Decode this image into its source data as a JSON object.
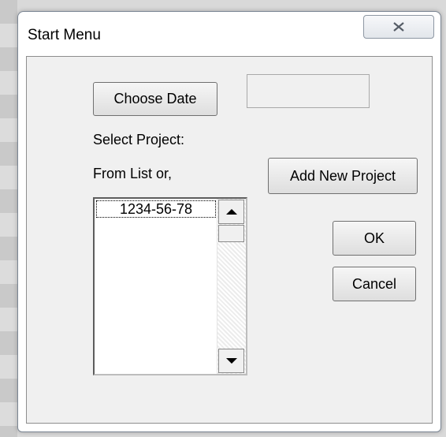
{
  "window": {
    "title": "Start Menu",
    "close_icon": "close-x-icon"
  },
  "form": {
    "choose_date_label": "Choose Date",
    "date_value": "",
    "select_project_label": "Select Project:",
    "from_list_label": "From List or,",
    "add_new_project_label": "Add New Project",
    "ok_label": "OK",
    "cancel_label": "Cancel"
  },
  "project_list": {
    "items": [
      "1234-56-78"
    ],
    "selected": "1234-56-78"
  },
  "colors": {
    "client_bg": "#f0f0f0",
    "window_border": "#7a8593"
  }
}
